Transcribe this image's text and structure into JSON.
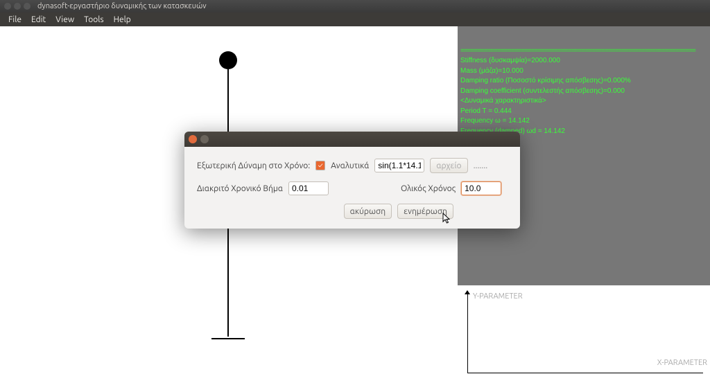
{
  "window": {
    "title": "dynasoft-εργαστήριο δυναμικής των κατασκευών"
  },
  "menubar": {
    "file": "File",
    "edit": "Edit",
    "view": "View",
    "tools": "Tools",
    "help": "Help"
  },
  "info_panel": {
    "separator": "======================================================================",
    "stiffness": "Stiffness (δυσκαμψία)=2000.000",
    "mass": "Mass (μάζα)=10.000",
    "damping_ratio": "Damping ratio (Ποσοστό κρίσιμης απόσβεσης)=0.000%",
    "damping_coeff": "Damping coefficient (συντελεστής απόσβεσης)=0.000",
    "chars_header": "<Δυναμικά χαρακτηριστικά>",
    "period": "Period T = 0.444",
    "freq": "Frequency ω = 14.142",
    "freq_damped": "Frequency (damped) ωd = 14.142"
  },
  "plot": {
    "y_label": "Y-PARAMETER",
    "x_label": "X-PARAMETER"
  },
  "dialog": {
    "row1_label": "Εξωτερική Δύναμη στο Χρόνο:",
    "analytical_label": "Αναλυτικά",
    "expr_value": "sin(1.1*14.1",
    "file_btn": "αρχείο",
    "dots": ".......",
    "row2_step_label": "Διακριτό Χρονικό Βήμα",
    "step_value": "0.01",
    "row2_total_label": "Ολικός Χρόνος",
    "total_value": "10.0",
    "cancel": "ακύρωση",
    "update": "ενημέρωση"
  }
}
